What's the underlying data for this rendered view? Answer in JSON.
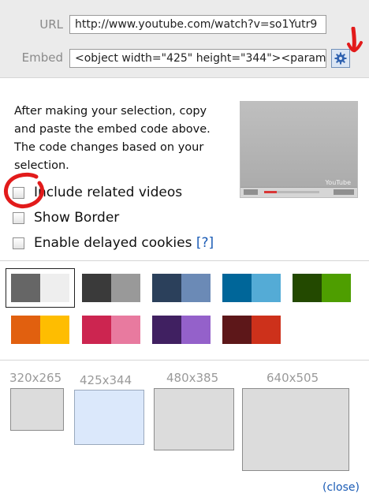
{
  "url": {
    "label": "URL",
    "value": "http://www.youtube.com/watch?v=so1Yutr9"
  },
  "embed": {
    "label": "Embed",
    "value": "<object width=\"425\" height=\"344\"><param"
  },
  "description": "After making your selection, copy and paste the embed code above. The code changes based on your selection.",
  "preview": {
    "logo_text": "YouTube"
  },
  "options": {
    "related": {
      "label": "Include related videos",
      "checked": false
    },
    "border": {
      "label": "Show Border",
      "checked": false
    },
    "cookies": {
      "label": "Enable delayed cookies",
      "help": "[?]",
      "checked": false
    }
  },
  "color_swatches": [
    {
      "name": "gray",
      "primary": "#666666",
      "secondary": "#eeeeee",
      "selected": true
    },
    {
      "name": "dark-gray",
      "primary": "#3a3a3a",
      "secondary": "#999999"
    },
    {
      "name": "navy",
      "primary": "#2b405b",
      "secondary": "#6b8ab6"
    },
    {
      "name": "blue",
      "primary": "#006699",
      "secondary": "#54abd6"
    },
    {
      "name": "green",
      "primary": "#234900",
      "secondary": "#4e9e00"
    },
    {
      "name": "orange",
      "primary": "#e1600f",
      "secondary": "#febd01"
    },
    {
      "name": "pink",
      "primary": "#cc2550",
      "secondary": "#e87a9f"
    },
    {
      "name": "purple",
      "primary": "#402061",
      "secondary": "#9461ca"
    },
    {
      "name": "red",
      "primary": "#5d1719",
      "secondary": "#cd311b"
    }
  ],
  "sizes": [
    {
      "label": "320x265",
      "selected": false
    },
    {
      "label": "425x344",
      "selected": true
    },
    {
      "label": "480x385",
      "selected": false
    },
    {
      "label": "640x505",
      "selected": false
    }
  ],
  "close_label": "(close)",
  "icons": {
    "settings": "gear-icon"
  }
}
